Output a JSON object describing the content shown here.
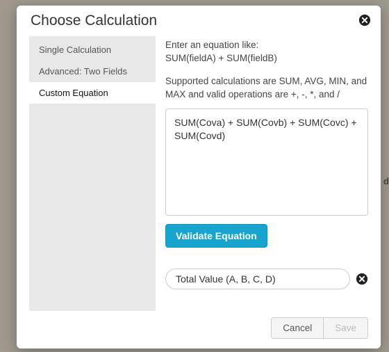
{
  "dialog": {
    "title": "Choose Calculation"
  },
  "sidebar": {
    "items": [
      {
        "label": "Single Calculation",
        "active": false
      },
      {
        "label": "Advanced: Two Fields",
        "active": false
      },
      {
        "label": "Custom Equation",
        "active": true
      }
    ]
  },
  "main": {
    "instruction_line1": "Enter an equation like:",
    "instruction_line2": "SUM(fieldA) + SUM(fieldB)",
    "supported": "Supported calculations are SUM, AVG, MIN, and MAX and valid operations are +, -, *, and /",
    "equation_value": "SUM(Cova) + SUM(Covb) + SUM(Covc) + SUM(Covd)",
    "validate_label": "Validate Equation",
    "label_value": "Total Value (A, B, C, D)"
  },
  "footer": {
    "cancel": "Cancel",
    "save": "Save"
  },
  "backdrop": {
    "hint": "d"
  }
}
